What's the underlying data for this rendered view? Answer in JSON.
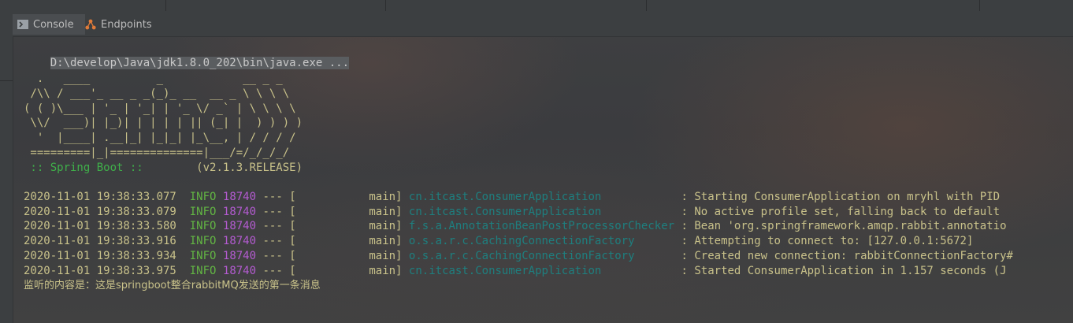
{
  "tabs": [
    {
      "label": "Console",
      "icon": "console-icon"
    },
    {
      "label": "Endpoints",
      "icon": "endpoints-icon"
    }
  ],
  "console": {
    "command": "D:\\develop\\Java\\jdk1.8.0_202\\bin\\java.exe ...",
    "banner": [
      "  .   ____          _            __ _ _",
      " /\\\\ / ___'_ __ _ _(_)_ __  __ _ \\ \\ \\ \\",
      "( ( )\\___ | '_ | '_| | '_ \\/ _` | \\ \\ \\ \\",
      " \\\\/  ___)| |_)| | | | | || (_| |  ) ) ) )",
      "  '  |____| .__|_| |_|_| |_\\__, | / / / /",
      " =========|_|==============|___/=/_/_/_/"
    ],
    "spring_label": " :: Spring Boot :: ",
    "version": "       (v2.1.3.RELEASE)",
    "logs": [
      {
        "ts": "2020-11-01 19:38:33.077",
        "level": "INFO",
        "pid": "18740",
        "sep": " --- [",
        "thread": "           main] ",
        "cls": "cn.itcast.ConsumerApplication           ",
        "msg": " : Starting ConsumerApplication on mryhl with PID"
      },
      {
        "ts": "2020-11-01 19:38:33.079",
        "level": "INFO",
        "pid": "18740",
        "sep": " --- [",
        "thread": "           main] ",
        "cls": "cn.itcast.ConsumerApplication           ",
        "msg": " : No active profile set, falling back to default"
      },
      {
        "ts": "2020-11-01 19:38:33.580",
        "level": "INFO",
        "pid": "18740",
        "sep": " --- [",
        "thread": "           main] ",
        "cls": "f.s.a.AnnotationBeanPostProcessorChecker",
        "msg": " : Bean 'org.springframework.amqp.rabbit.annotatio"
      },
      {
        "ts": "2020-11-01 19:38:33.916",
        "level": "INFO",
        "pid": "18740",
        "sep": " --- [",
        "thread": "           main] ",
        "cls": "o.s.a.r.c.CachingConnectionFactory      ",
        "msg": " : Attempting to connect to: [127.0.0.1:5672]"
      },
      {
        "ts": "2020-11-01 19:38:33.934",
        "level": "INFO",
        "pid": "18740",
        "sep": " --- [",
        "thread": "           main] ",
        "cls": "o.s.a.r.c.CachingConnectionFactory      ",
        "msg": " : Created new connection: rabbitConnectionFactory#"
      },
      {
        "ts": "2020-11-01 19:38:33.975",
        "level": "INFO",
        "pid": "18740",
        "sep": " --- [",
        "thread": "           main] ",
        "cls": "cn.itcast.ConsumerApplication           ",
        "msg": " : Started ConsumerApplication in 1.157 seconds (J"
      }
    ],
    "message": "监听的内容是：这是springboot整合rabbitMQ发送的第一条消息"
  },
  "colors": {
    "background": "#3a3d40",
    "info": "#62b543",
    "pid": "#b35bd0",
    "logger": "#1e7f7f",
    "text": "#c9c28a",
    "spring": "#3fb04a"
  }
}
